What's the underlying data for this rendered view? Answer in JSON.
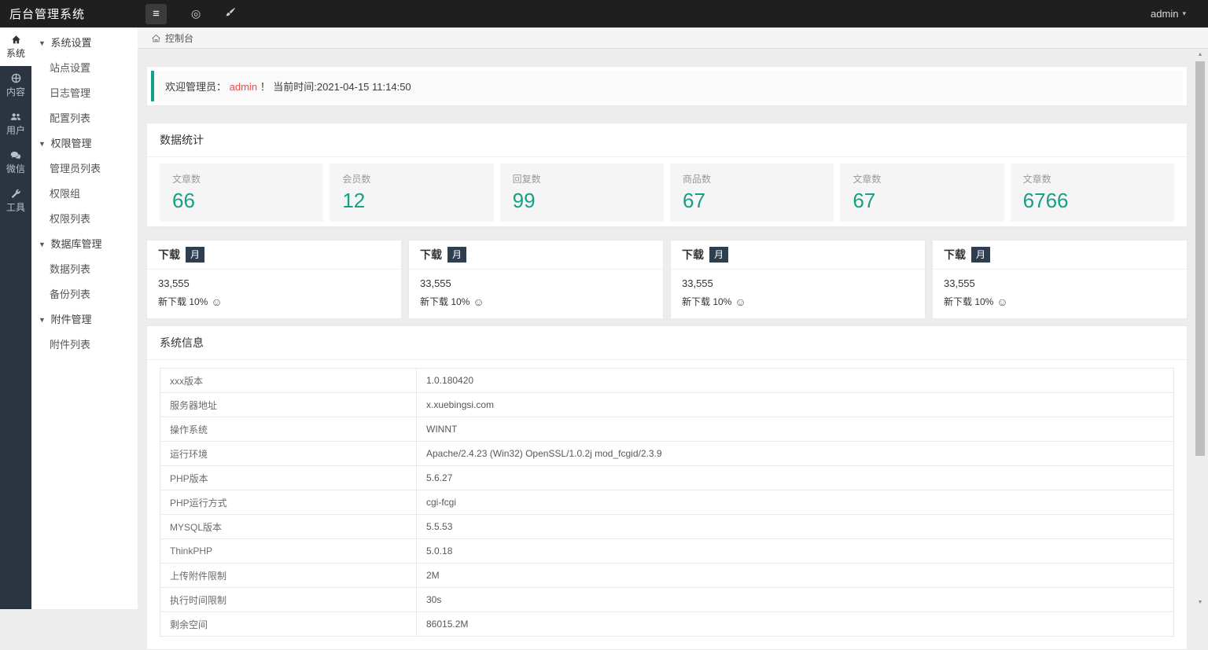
{
  "icons": {
    "hamburger": "≡",
    "refresh": "◎",
    "caret_down": "▼",
    "caret_small": "▾",
    "smiley": "☺",
    "scroll_up": "▲",
    "scroll_down": "▼"
  },
  "colors": {
    "accent_teal": "#16a085",
    "badge_navy": "#2c3e50",
    "user_red": "#ef4b4b",
    "rail_bg": "#2b3542",
    "topbar_bg": "#1f1f1f"
  },
  "topbar": {
    "title": "后台管理系统",
    "user_label": "admin"
  },
  "rail": {
    "items": [
      {
        "id": "system",
        "label": "系统",
        "icon": "home-icon",
        "active": true
      },
      {
        "id": "content",
        "label": "内容",
        "icon": "globe-icon",
        "active": false
      },
      {
        "id": "users",
        "label": "用户",
        "icon": "users-icon",
        "active": false
      },
      {
        "id": "wechat",
        "label": "微信",
        "icon": "chat-icon",
        "active": false
      },
      {
        "id": "tools",
        "label": "工具",
        "icon": "tools-icon",
        "active": false
      }
    ]
  },
  "sidebar": {
    "groups": [
      {
        "label": "系统设置",
        "items": [
          "站点设置",
          "日志管理",
          "配置列表"
        ]
      },
      {
        "label": "权限管理",
        "items": [
          "管理员列表",
          "权限组",
          "权限列表"
        ]
      },
      {
        "label": "数据库管理",
        "items": [
          "数据列表",
          "备份列表"
        ]
      },
      {
        "label": "附件管理",
        "items": [
          "附件列表"
        ]
      }
    ]
  },
  "breadcrumb": {
    "label": "控制台"
  },
  "welcome": {
    "prefix": "欢迎管理员：",
    "user": "admin",
    "suffix": "！ 当前时间:2021-04-15 11:14:50"
  },
  "stats_panel": {
    "title": "数据统计",
    "cards": [
      {
        "label": "文章数",
        "value": "66"
      },
      {
        "label": "会员数",
        "value": "12"
      },
      {
        "label": "回复数",
        "value": "99"
      },
      {
        "label": "商品数",
        "value": "67"
      },
      {
        "label": "文章数",
        "value": "67"
      },
      {
        "label": "文章数",
        "value": "6766"
      }
    ]
  },
  "download_section": {
    "cards": [
      {
        "title": "下载",
        "badge": "月",
        "value": "33,555",
        "subtitle": "新下载 10%"
      },
      {
        "title": "下载",
        "badge": "月",
        "value": "33,555",
        "subtitle": "新下载 10%"
      },
      {
        "title": "下载",
        "badge": "月",
        "value": "33,555",
        "subtitle": "新下载 10%"
      },
      {
        "title": "下载",
        "badge": "月",
        "value": "33,555",
        "subtitle": "新下载 10%"
      }
    ]
  },
  "system_panel": {
    "title": "系统信息",
    "rows": [
      {
        "label": "xxx版本",
        "value": "1.0.180420"
      },
      {
        "label": "服务器地址",
        "value": "x.xuebingsi.com"
      },
      {
        "label": "操作系统",
        "value": "WINNT"
      },
      {
        "label": "运行环境",
        "value": "Apache/2.4.23 (Win32) OpenSSL/1.0.2j mod_fcgid/2.3.9"
      },
      {
        "label": "PHP版本",
        "value": "5.6.27"
      },
      {
        "label": "PHP运行方式",
        "value": "cgi-fcgi"
      },
      {
        "label": "MYSQL版本",
        "value": "5.5.53"
      },
      {
        "label": "ThinkPHP",
        "value": "5.0.18"
      },
      {
        "label": "上传附件限制",
        "value": "2M"
      },
      {
        "label": "执行时间限制",
        "value": "30s"
      },
      {
        "label": "剩余空间",
        "value": "86015.2M"
      }
    ]
  }
}
